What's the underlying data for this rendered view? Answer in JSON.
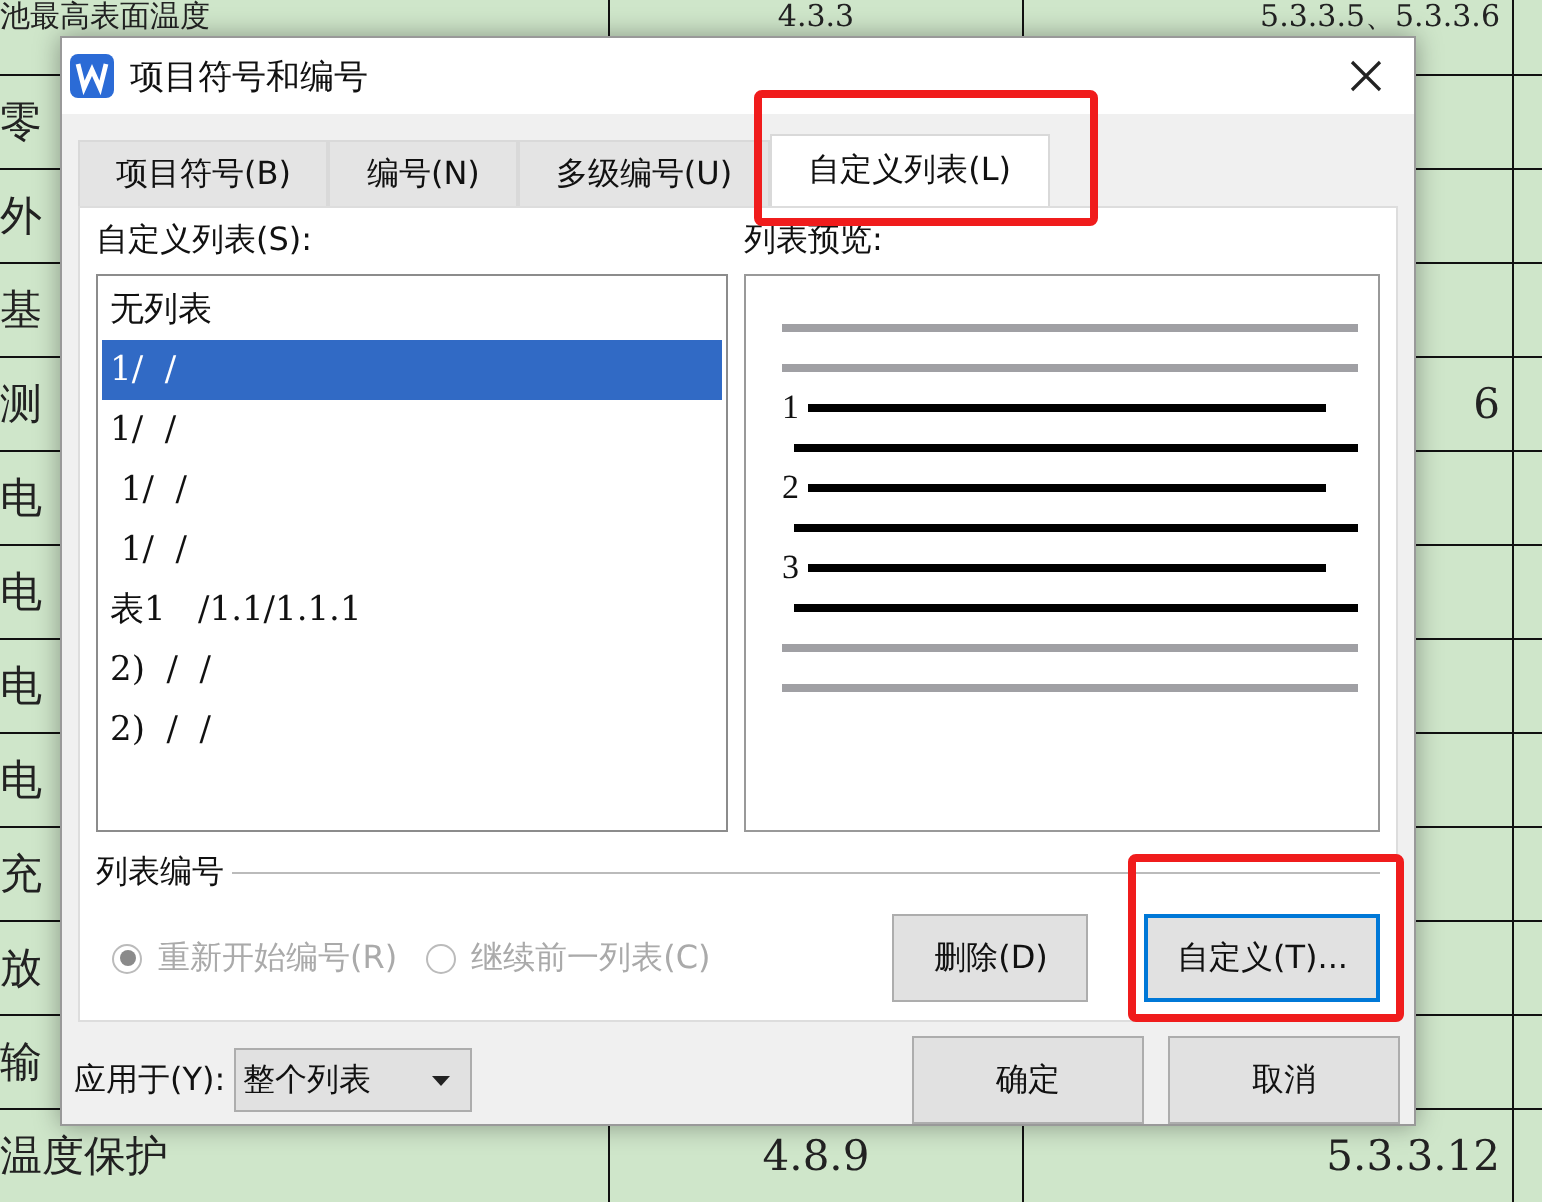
{
  "background_table": {
    "rows": [
      {
        "column_1": "池最高表面温度",
        "column_2": "4.3.3",
        "column_3": "5.3.3.5、5.3.3.6",
        "column_4": ""
      },
      {
        "column_1": "零",
        "column_2": "",
        "column_3": "",
        "column_4": ""
      },
      {
        "column_1": "外",
        "column_2": "",
        "column_3": "",
        "column_4": ""
      },
      {
        "column_1": "基",
        "column_2": "",
        "column_3": "",
        "column_4": ""
      },
      {
        "column_1": "测",
        "column_2": "",
        "column_3": "6",
        "column_4": ""
      },
      {
        "column_1": "电",
        "column_2": "",
        "column_3": "",
        "column_4": ""
      },
      {
        "column_1": "电",
        "column_2": "",
        "column_3": "",
        "column_4": ""
      },
      {
        "column_1": "电",
        "column_2": "",
        "column_3": "",
        "column_4": ""
      },
      {
        "column_1": "电",
        "column_2": "",
        "column_3": "",
        "column_4": ""
      },
      {
        "column_1": "充",
        "column_2": "",
        "column_3": "",
        "column_4": ""
      },
      {
        "column_1": "放",
        "column_2": "",
        "column_3": "",
        "column_4": ""
      },
      {
        "column_1": "输",
        "column_2": "",
        "column_3": "",
        "column_4": ""
      },
      {
        "column_1": "温度保护",
        "column_2": "4.8.9",
        "column_3": "5.3.3.12",
        "column_4": ""
      }
    ]
  },
  "dialog": {
    "title": "项目符号和编号",
    "tabs": [
      {
        "label": "项目符号(B)",
        "selected": false,
        "highlighted": false
      },
      {
        "label": "编号(N)",
        "selected": false,
        "highlighted": false
      },
      {
        "label": "多级编号(U)",
        "selected": false,
        "highlighted": false
      },
      {
        "label": "自定义列表(L)",
        "selected": true,
        "highlighted": true
      }
    ],
    "custom_list": {
      "label": "自定义列表(S):",
      "items": [
        {
          "text": "无列表",
          "selected": false
        },
        {
          "text": "1/  /",
          "selected": true
        },
        {
          "text": "1/  /",
          "selected": false
        },
        {
          "text": " 1/  /",
          "selected": false
        },
        {
          "text": " 1/  /",
          "selected": false
        },
        {
          "text": "表1   /1.1/1.1.1",
          "selected": false
        },
        {
          "text": "2)  /  /",
          "selected": false
        },
        {
          "text": "2)  /  /",
          "selected": false
        }
      ]
    },
    "preview": {
      "label": "列表预览:",
      "numbers": [
        "1",
        "2",
        "3"
      ]
    },
    "list_numbering": {
      "label": "列表编号",
      "options": [
        {
          "label": "重新开始编号(R)",
          "selected": true,
          "disabled": true
        },
        {
          "label": "继续前一列表(C)",
          "selected": false,
          "disabled": true
        }
      ]
    },
    "buttons": [
      {
        "label": "删除(D)",
        "highlighted": false,
        "focused": false
      },
      {
        "label": "自定义(T)...",
        "highlighted": true,
        "focused": true
      }
    ],
    "apply_to": {
      "label": "应用于(Y):",
      "value": "整个列表"
    },
    "footer_buttons": [
      "确定",
      "取消"
    ]
  }
}
